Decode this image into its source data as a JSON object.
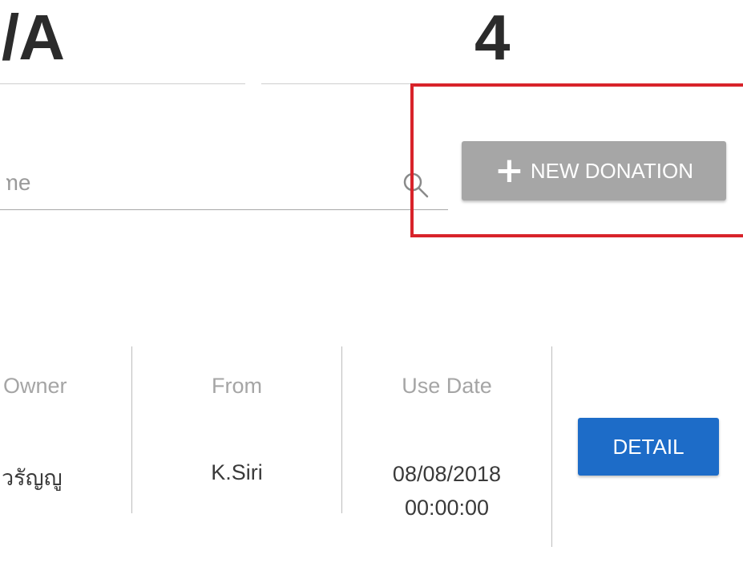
{
  "stats": {
    "left_value": "/A",
    "right_value": "4"
  },
  "search": {
    "placeholder": "ame",
    "value": ""
  },
  "toolbar": {
    "new_donation_icon": "+",
    "new_donation_label": "NEW DONATION"
  },
  "table": {
    "headers": {
      "owner": "Owner",
      "from": "From",
      "use_date": "Use Date"
    },
    "rows": [
      {
        "owner": "วรัญญู",
        "from": "K.Siri",
        "use_date_day": "08/08/2018",
        "use_date_time": "00:00:00",
        "action_label": "DETAIL"
      }
    ]
  },
  "colors": {
    "highlight": "#d8232a",
    "new_donation_bg": "#a6a6a6",
    "detail_bg": "#1d6cc8"
  }
}
